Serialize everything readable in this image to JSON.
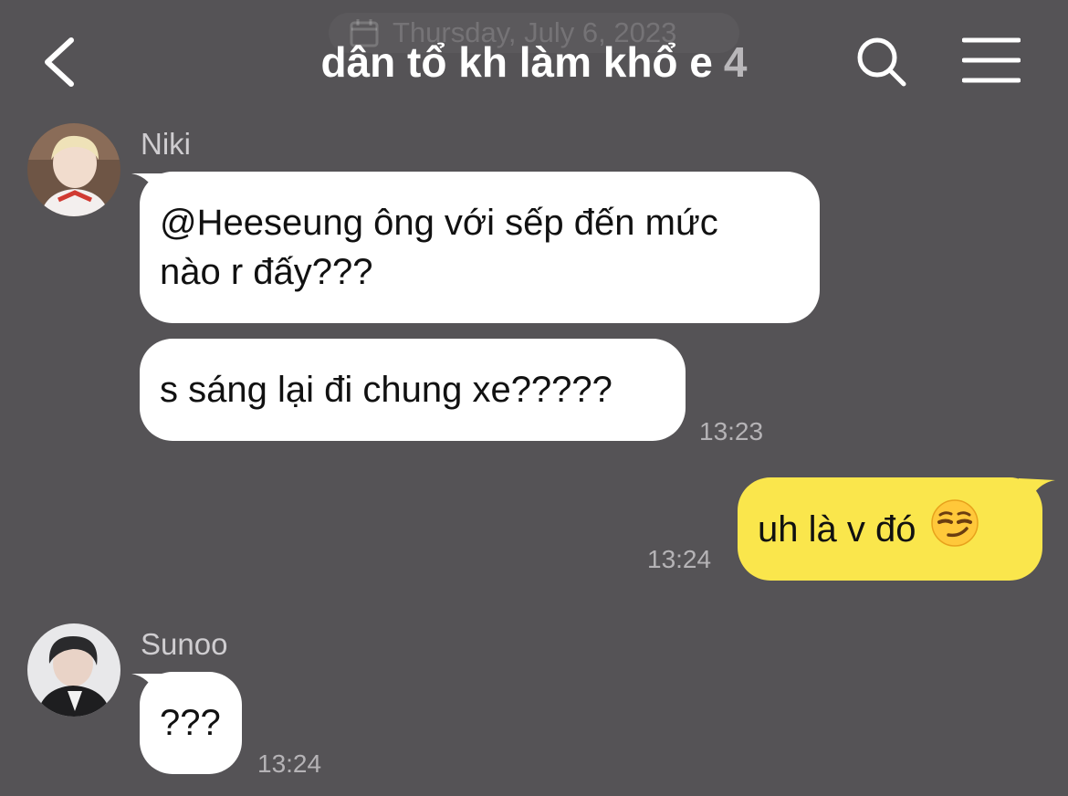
{
  "header": {
    "date_label": "Thursday, July 6, 2023",
    "title": "dân tổ kh làm khổ e",
    "member_count": "4"
  },
  "icons": {
    "back": "chevron-left-icon",
    "search": "search-icon",
    "menu": "hamburger-menu-icon",
    "calendar": "calendar-icon",
    "emoji": "smirking-face-emoji"
  },
  "colors": {
    "background": "#555356",
    "incoming_bubble": "#ffffff",
    "outgoing_bubble": "#fae64c"
  },
  "messages": [
    {
      "sender": "Niki",
      "bubbles": [
        "@Heeseung ông với sếp đến mức\nnào r đấy???",
        "s sáng lại đi chung xe?????"
      ],
      "time": "13:23"
    },
    {
      "sender": "me",
      "bubbles": [
        "uh là v đó"
      ],
      "emoji": "😏",
      "time": "13:24"
    },
    {
      "sender": "Sunoo",
      "bubbles": [
        "???"
      ],
      "time": "13:24"
    }
  ]
}
